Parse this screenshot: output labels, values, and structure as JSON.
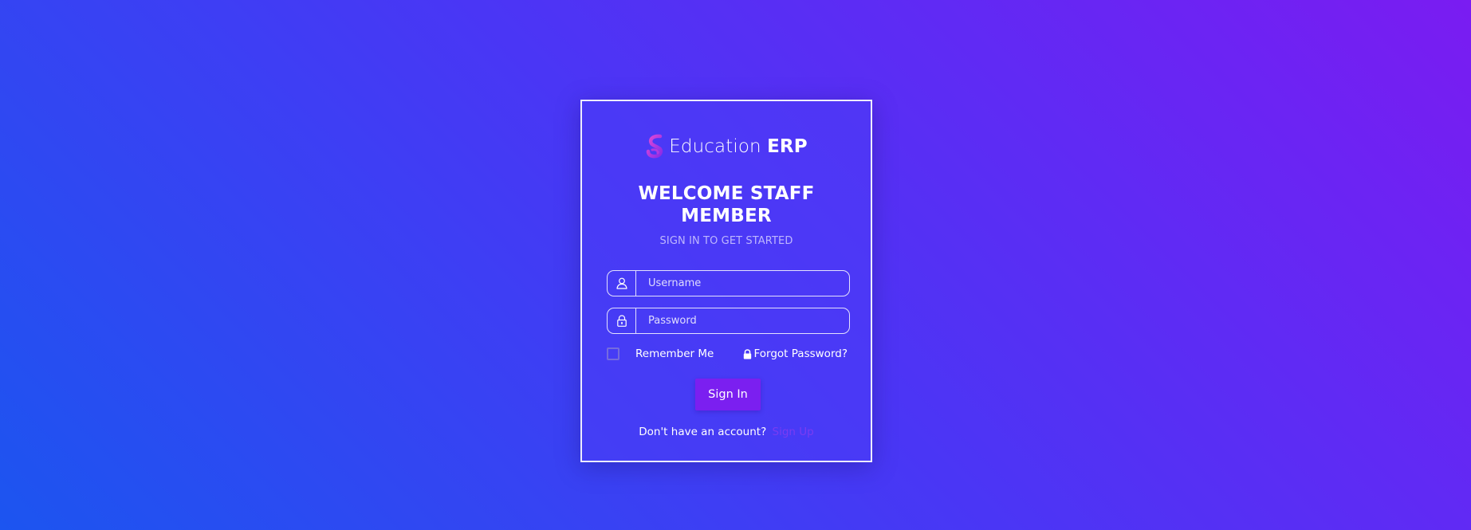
{
  "brand": {
    "name_light": "Education ",
    "name_bold": "ERP",
    "logo_icon": "s-swirl-logo"
  },
  "welcome": {
    "line1": "WELCOME STAFF",
    "line2": "MEMBER"
  },
  "subtitle": "SIGN IN TO GET STARTED",
  "form": {
    "username_placeholder": "Username",
    "username_icon": "user-icon",
    "password_placeholder": "Password",
    "password_icon": "lock-icon",
    "remember_label": "Remember Me",
    "remember_checked": false,
    "forgot_label": "Forgot Password?",
    "forgot_icon": "lock-icon",
    "submit_label": "Sign In"
  },
  "signup": {
    "prompt": "Don't have an account?",
    "link_label": "Sign Up"
  },
  "colors": {
    "gradient_start": "#1c55f0",
    "gradient_end": "#7a1cf2",
    "button": "#7b1ff0",
    "link": "#7a3cf2",
    "logo": "#c23ae6"
  }
}
